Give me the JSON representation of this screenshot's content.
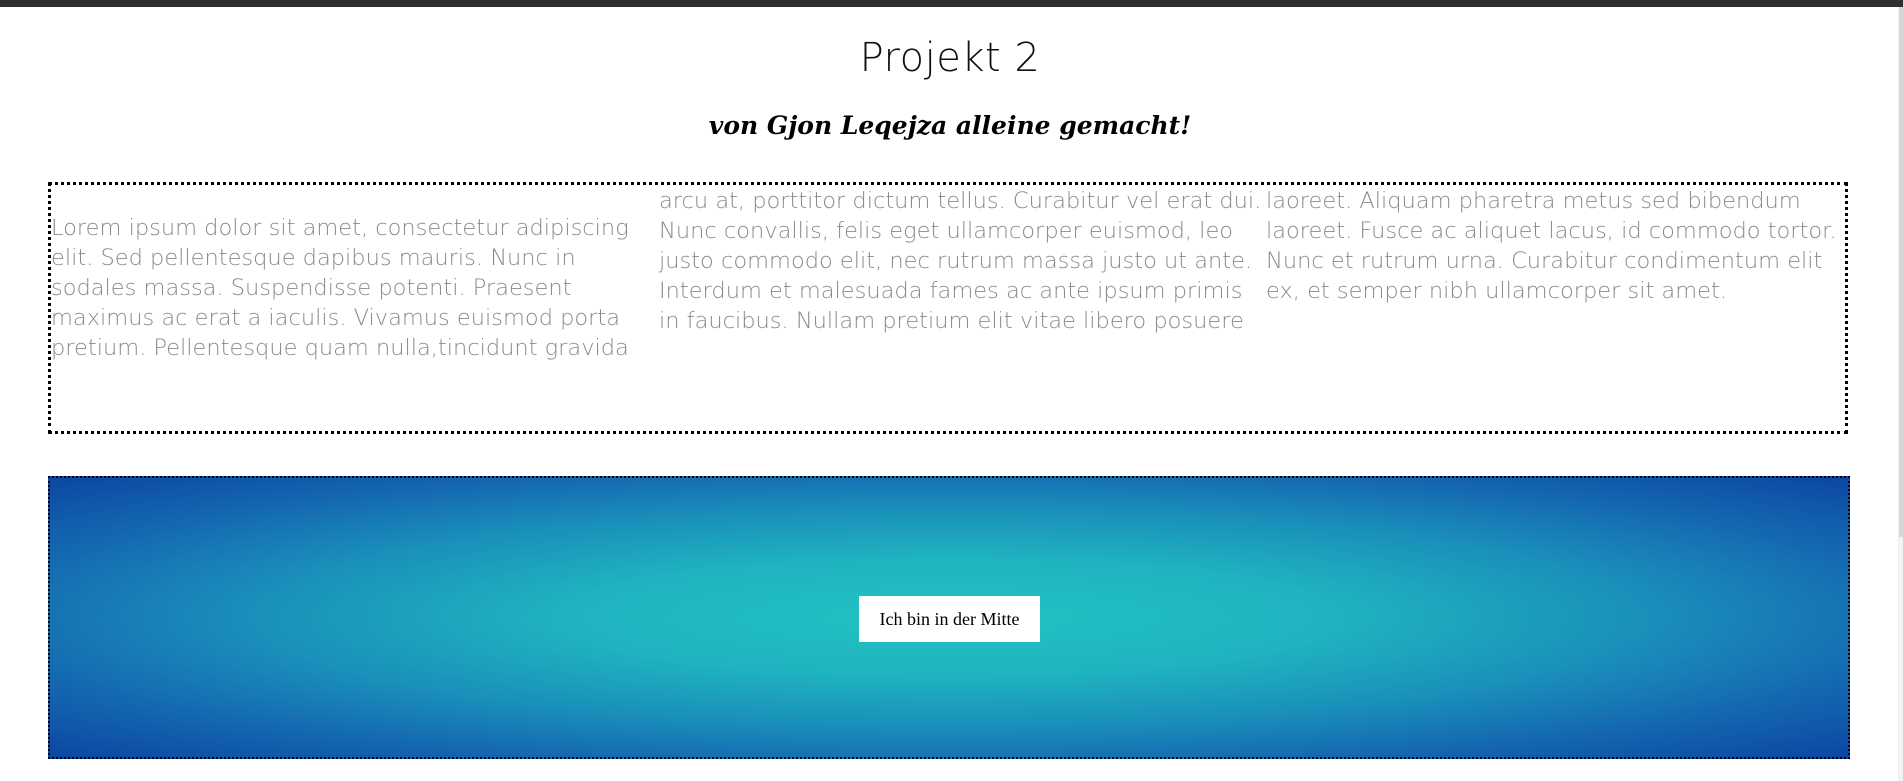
{
  "page": {
    "title": "Projekt 2",
    "subtitle": "von Gjon Leqejza alleine gemacht!"
  },
  "text_box": {
    "column_1": [
      "Lorem ipsum dolor sit amet, consectetur adipiscing",
      "elit. Sed pellentesque dapibus mauris. Nunc in",
      "sodales massa. Suspendisse potenti. Praesent",
      "maximus ac erat a iaculis. Vivamus euismod porta",
      "pretium. Pellentesque quam nulla,tincidunt gravida"
    ],
    "column_2": [
      "arcu at, porttitor dictum tellus. Curabitur vel erat dui.",
      "Nunc convallis, felis eget ullamcorper euismod, leo",
      "justo commodo elit, nec rutrum massa justo ut ante.",
      "Interdum et malesuada fames ac ante ipsum primis",
      "in faucibus. Nullam pretium elit vitae libero posuere"
    ],
    "column_3": [
      "laoreet. Aliquam pharetra metus sed bibendum",
      "laoreet. Fusce ac aliquet lacus, id commodo tortor.",
      "Nunc et rutrum urna. Curabitur condimentum elit",
      "ex, et semper nibh ullamcorper sit amet."
    ]
  },
  "gradient_box": {
    "button_label": "Ich bin in der Mitte",
    "colors": {
      "center": "#22c2c2",
      "edge": "#0b47a3"
    }
  },
  "colors": {
    "top_bar": "#2f2f2f",
    "body_text": "#8a8a8a",
    "heading": "#111111"
  }
}
